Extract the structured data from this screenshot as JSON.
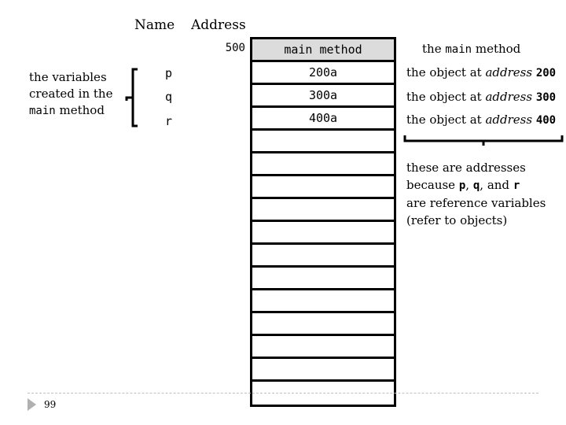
{
  "headers": {
    "name": "Name",
    "address": "Address"
  },
  "memory_table": {
    "start_address": "500",
    "head_cell": "main method",
    "cells": [
      "200a",
      "300a",
      "400a",
      "",
      "",
      "",
      "",
      "",
      "",
      "",
      "",
      "",
      "",
      "",
      ""
    ]
  },
  "variables": {
    "label_lines": [
      "the variables",
      "created in the"
    ],
    "label_code": "main",
    "label_tail": "method",
    "names": [
      "p",
      "q",
      "r"
    ]
  },
  "descriptions": {
    "main_prefix": "the",
    "main_code": "main",
    "main_suffix": "method",
    "objects": [
      {
        "prefix": "the object at",
        "italic": "address",
        "value": "200"
      },
      {
        "prefix": "the object at",
        "italic": "address",
        "value": "300"
      },
      {
        "prefix": "the object at",
        "italic": "address",
        "value": "400"
      }
    ]
  },
  "note": {
    "line1": "these are addresses",
    "line2_prefix": "because",
    "p": "p",
    "sep1": ",",
    "q": "q",
    "sep2": ", and",
    "r": "r",
    "line3": "are reference variables",
    "line4": "(refer to objects)"
  },
  "footer": {
    "page_number": "99"
  }
}
